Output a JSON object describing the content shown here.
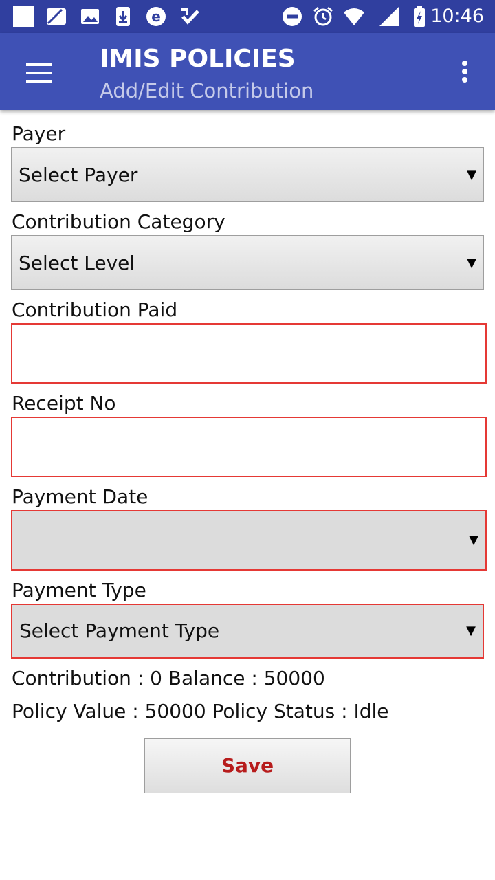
{
  "status_bar": {
    "time": "10:46",
    "icons": [
      "notification-square-icon",
      "cast-icon",
      "image-icon",
      "download-icon",
      "e-app-icon",
      "tasks-check-icon",
      "do-not-disturb-icon",
      "alarm-icon",
      "wifi-icon",
      "signal-icon",
      "battery-charging-icon"
    ]
  },
  "app_bar": {
    "title": "IMIS POLICIES",
    "subtitle": "Add/Edit Contribution",
    "background": "#3F51B5",
    "status_background": "#303F9F"
  },
  "form": {
    "payer": {
      "label": "Payer",
      "value": "Select Payer"
    },
    "category": {
      "label": "Contribution Category",
      "value": "Select Level"
    },
    "paid": {
      "label": "Contribution Paid",
      "value": ""
    },
    "receipt": {
      "label": "Receipt No",
      "value": ""
    },
    "payment_date": {
      "label": "Payment Date",
      "value": ""
    },
    "payment_type": {
      "label": "Payment Type",
      "value": "Select Payment Type"
    },
    "error_color": "#E53935"
  },
  "summary": {
    "line1": "Contribution : 0 Balance : 50000",
    "line2": "Policy Value : 50000 Policy Status : Idle"
  },
  "actions": {
    "save_label": "Save",
    "save_color": "#B71C1C"
  }
}
